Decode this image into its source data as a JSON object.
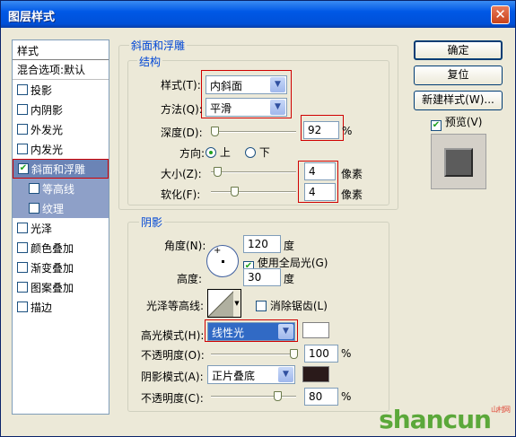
{
  "window": {
    "title": "图层样式"
  },
  "sidebar": {
    "header": "样式",
    "blend": "混合选项:默认",
    "items": [
      {
        "label": "投影",
        "checked": false,
        "kind": "normal"
      },
      {
        "label": "内阴影",
        "checked": false,
        "kind": "normal"
      },
      {
        "label": "外发光",
        "checked": false,
        "kind": "normal"
      },
      {
        "label": "内发光",
        "checked": false,
        "kind": "normal"
      },
      {
        "label": "斜面和浮雕",
        "checked": true,
        "kind": "selected"
      },
      {
        "label": "等高线",
        "checked": false,
        "kind": "sub"
      },
      {
        "label": "纹理",
        "checked": false,
        "kind": "sub"
      },
      {
        "label": "光泽",
        "checked": false,
        "kind": "normal"
      },
      {
        "label": "颜色叠加",
        "checked": false,
        "kind": "normal"
      },
      {
        "label": "渐变叠加",
        "checked": false,
        "kind": "normal"
      },
      {
        "label": "图案叠加",
        "checked": false,
        "kind": "normal"
      },
      {
        "label": "描边",
        "checked": false,
        "kind": "normal"
      }
    ]
  },
  "bevel": {
    "group_title": "斜面和浮雕",
    "structure_title": "结构",
    "style_label": "样式(T):",
    "style_value": "内斜面",
    "technique_label": "方法(Q):",
    "technique_value": "平滑",
    "depth_label": "深度(D):",
    "depth_value": "92",
    "depth_unit": "%",
    "depth_slider": 0.0,
    "direction_label": "方向:",
    "dir_up": "上",
    "dir_down": "下",
    "size_label": "大小(Z):",
    "size_value": "4",
    "size_unit": "像素",
    "size_slider": 0.03,
    "soften_label": "软化(F):",
    "soften_value": "4",
    "soften_unit": "像素",
    "soften_slider": 0.25
  },
  "shading": {
    "title": "阴影",
    "angle_label": "角度(N):",
    "angle_value": "120",
    "angle_unit": "度",
    "global_light_label": "使用全局光(G)",
    "global_light_checked": true,
    "altitude_label": "高度:",
    "altitude_value": "30",
    "altitude_unit": "度",
    "gloss_label": "光泽等高线:",
    "antialias_label": "消除锯齿(L)",
    "highlight_mode_label": "高光模式(H):",
    "highlight_mode_value": "线性光",
    "highlight_color": "#ffffff",
    "highlight_opacity_label": "不透明度(O):",
    "highlight_opacity_value": "100",
    "highlight_opacity_unit": "%",
    "highlight_opacity_slider": 1.0,
    "shadow_mode_label": "阴影模式(A):",
    "shadow_mode_value": "正片叠底",
    "shadow_color": "#2a1a1a",
    "shadow_opacity_label": "不透明度(C):",
    "shadow_opacity_value": "80",
    "shadow_opacity_unit": "%",
    "shadow_opacity_slider": 0.8
  },
  "buttons": {
    "ok": "确定",
    "reset": "复位",
    "new_style": "新建样式(W)...",
    "preview_label": "预览(V)",
    "preview_checked": true
  },
  "watermark": {
    "text": "shancun",
    "small": "山村网"
  }
}
